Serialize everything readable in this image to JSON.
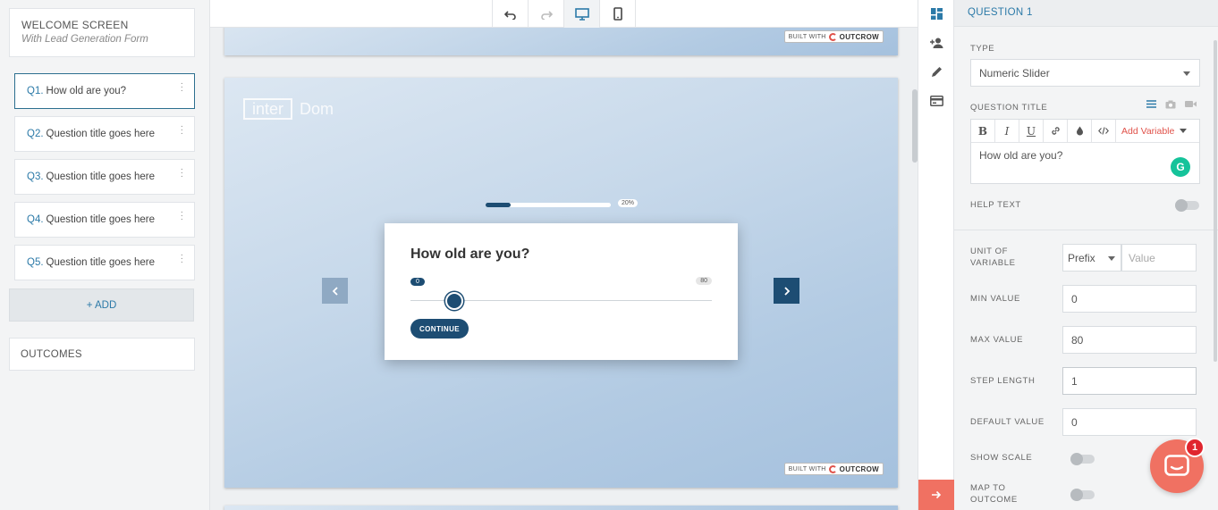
{
  "sidebar": {
    "welcome_title": "WELCOME SCREEN",
    "welcome_subtitle": "With Lead Generation Form",
    "questions": [
      {
        "num": "Q1.",
        "title": "How old are you?"
      },
      {
        "num": "Q2.",
        "title": "Question title goes here"
      },
      {
        "num": "Q3.",
        "title": "Question title goes here"
      },
      {
        "num": "Q4.",
        "title": "Question title goes here"
      },
      {
        "num": "Q5.",
        "title": "Question title goes here"
      }
    ],
    "add_label": "+ ADD",
    "outcomes_label": "OUTCOMES"
  },
  "toolbar": {
    "icons": [
      "undo-icon",
      "redo-icon",
      "desktop-icon",
      "mobile-icon"
    ],
    "active": "desktop-icon"
  },
  "preview": {
    "built_with": "BUILT WITH",
    "brand": "OUTCROW",
    "watermark_box": "inter",
    "watermark_text": "Dom",
    "progress_percent": 20,
    "progress_label": "20%",
    "question_title": "How old are you?",
    "slider_min_label": "0",
    "slider_max_label": "80",
    "slider_value": 0,
    "continue_label": "CONTINUE"
  },
  "rail": {
    "icons": [
      "layout-icon",
      "add-user-icon",
      "pencil-icon",
      "card-icon",
      "arrow-right-icon"
    ]
  },
  "panel": {
    "header": "QUESTION 1",
    "type_label": "TYPE",
    "type_value": "Numeric Slider",
    "question_title_label": "QUESTION TITLE",
    "add_variable": "Add Variable",
    "question_title_value": "How old are you?",
    "help_text_label": "HELP TEXT",
    "unit_label": "UNIT OF VARIABLE",
    "unit_prefix": "Prefix",
    "unit_value_placeholder": "Value",
    "min_label": "MIN VALUE",
    "min_value": "0",
    "max_label": "MAX VALUE",
    "max_value": "80",
    "step_label": "STEP LENGTH",
    "step_value": "1",
    "default_label": "DEFAULT VALUE",
    "default_value": "0",
    "show_scale_label": "SHOW SCALE",
    "map_outcome_label": "MAP TO OUTCOME"
  },
  "chat": {
    "badge_count": "1"
  },
  "colors": {
    "accent": "#1d4d73",
    "link": "#2c7aa8",
    "brand": "#f07162"
  }
}
